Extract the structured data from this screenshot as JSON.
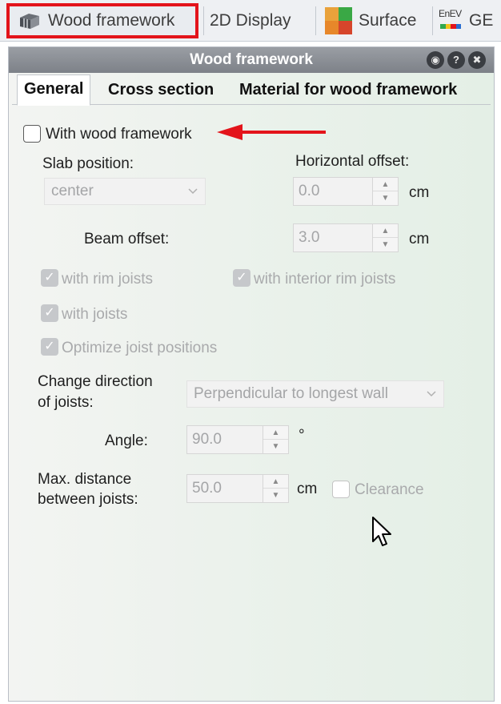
{
  "ribbon": {
    "tabs": [
      {
        "label": "Wood framework",
        "icon": "wood-framework-icon"
      },
      {
        "label": "2D Display"
      },
      {
        "label": "Surface",
        "icon": "surface-icon"
      },
      {
        "label": "GE",
        "icon": "enev-icon",
        "icon_text": "EnEV"
      }
    ],
    "highlight_color": "#e3141b"
  },
  "panel": {
    "title": "Wood framework",
    "title_buttons": [
      "◉",
      "?",
      "✖"
    ],
    "subtabs": [
      "General",
      "Cross section",
      "Material for wood framework"
    ],
    "general": {
      "with_wood_framework": {
        "label": "With wood framework",
        "checked": false
      },
      "slab_position": {
        "label": "Slab position:",
        "value": "center"
      },
      "horizontal_offset": {
        "label": "Horizontal offset:",
        "value": "0.0",
        "unit": "cm"
      },
      "beam_offset": {
        "label": "Beam offset:",
        "value": "3.0",
        "unit": "cm"
      },
      "with_rim_joists": {
        "label": "with rim joists",
        "checked": true
      },
      "with_interior_rim_joists": {
        "label": "with interior rim joists",
        "checked": true
      },
      "with_joists": {
        "label": "with joists",
        "checked": true
      },
      "optimize_joist_positions": {
        "label": "Optimize joist positions",
        "checked": true
      },
      "change_direction": {
        "label_line1": "Change direction",
        "label_line2": "of joists:",
        "value": "Perpendicular to longest wall"
      },
      "angle": {
        "label": "Angle:",
        "value": "90.0",
        "unit": "°"
      },
      "max_distance": {
        "label_line1": "Max. distance",
        "label_line2": "between joists:",
        "value": "50.0",
        "unit": "cm"
      },
      "clearance": {
        "label": "Clearance",
        "checked": false
      }
    }
  },
  "annotation": {
    "arrow_color": "#e3141b"
  }
}
